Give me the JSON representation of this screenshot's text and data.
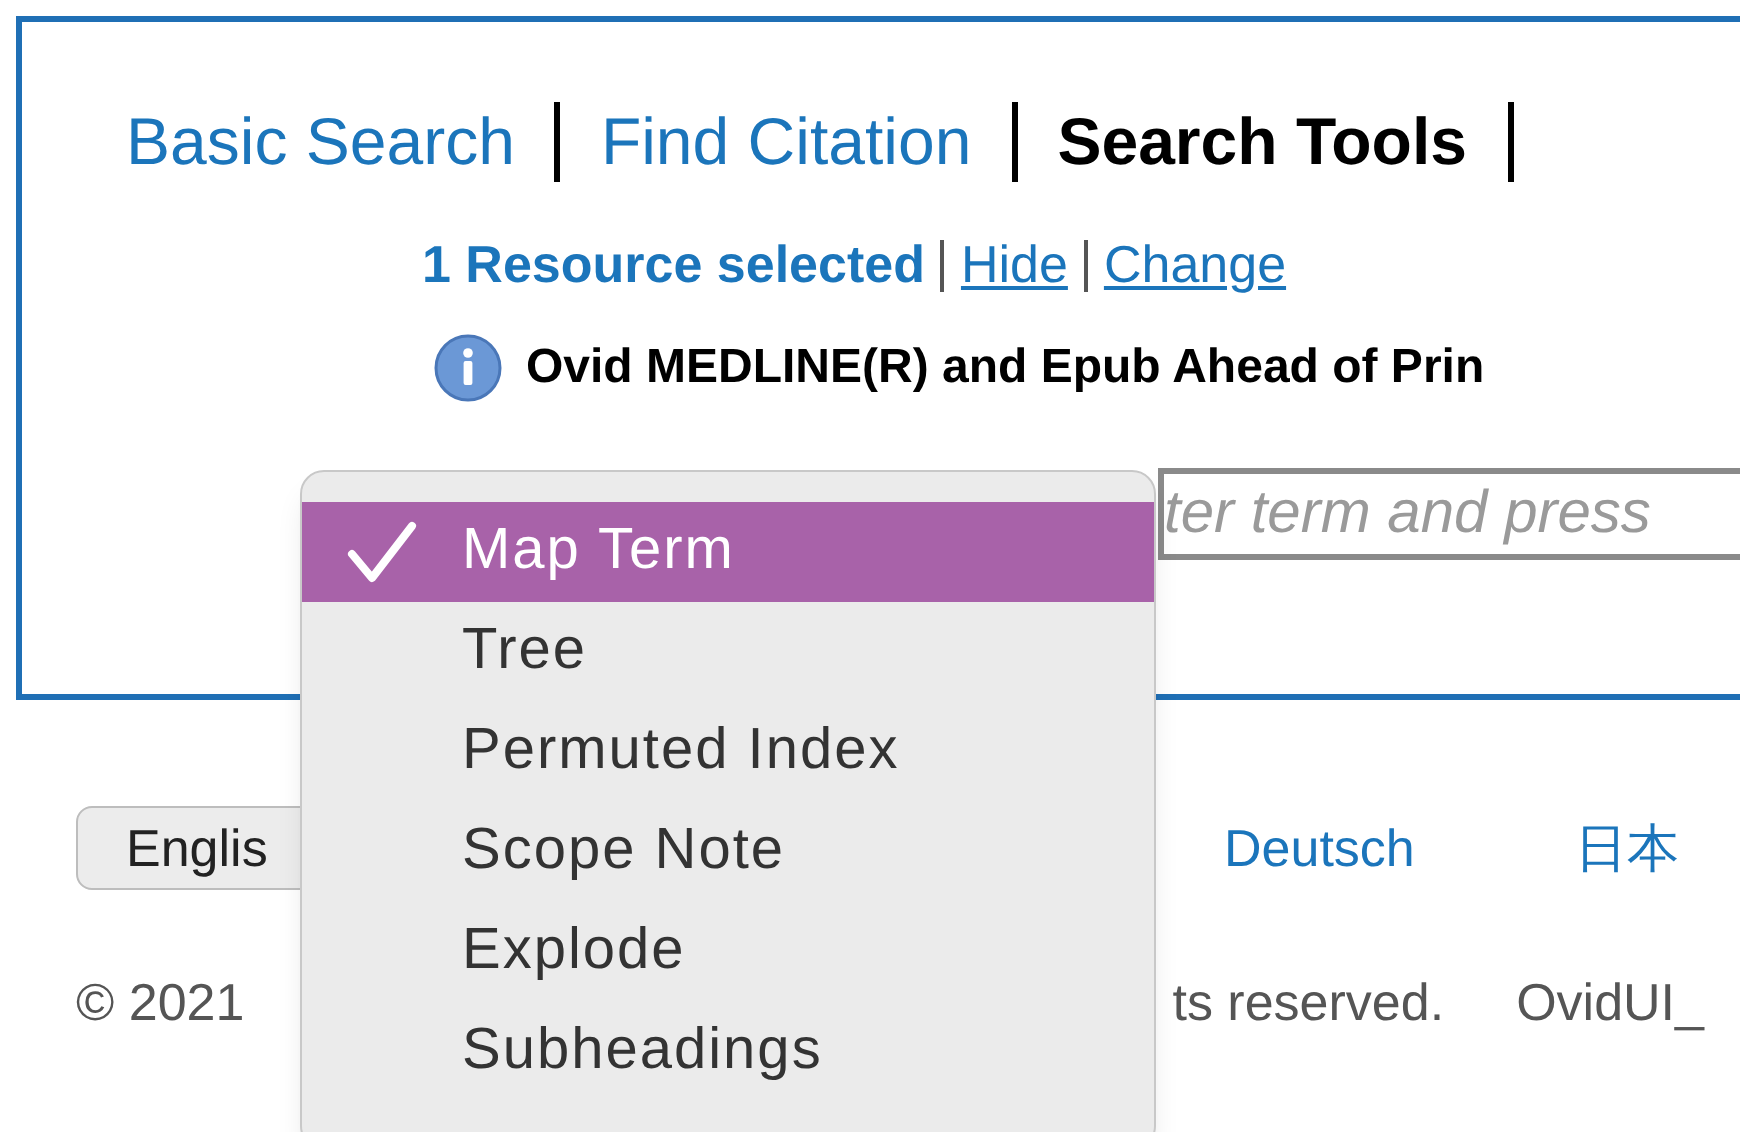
{
  "tabs": [
    {
      "label": "Basic Search",
      "selected": false
    },
    {
      "label": "Find Citation",
      "selected": false
    },
    {
      "label": "Search Tools",
      "selected": true
    }
  ],
  "resources": {
    "count_text": "1 Resource selected",
    "links": [
      "Hide",
      "Change"
    ],
    "database": "Ovid MEDLINE(R) and Epub Ahead of Prin"
  },
  "search": {
    "placeholder": "ter term and press"
  },
  "tool_menu": {
    "items": [
      {
        "label": "Map Term",
        "selected": true
      },
      {
        "label": "Tree",
        "selected": false
      },
      {
        "label": "Permuted Index",
        "selected": false
      },
      {
        "label": "Scope Note",
        "selected": false
      },
      {
        "label": "Explode",
        "selected": false
      },
      {
        "label": "Subheadings",
        "selected": false
      }
    ]
  },
  "languages": {
    "current": "Englis",
    "links": [
      "Deutsch",
      "日本"
    ]
  },
  "footer": {
    "texts": [
      "© 2021",
      "ts reserved.",
      "OvidUI_"
    ]
  }
}
